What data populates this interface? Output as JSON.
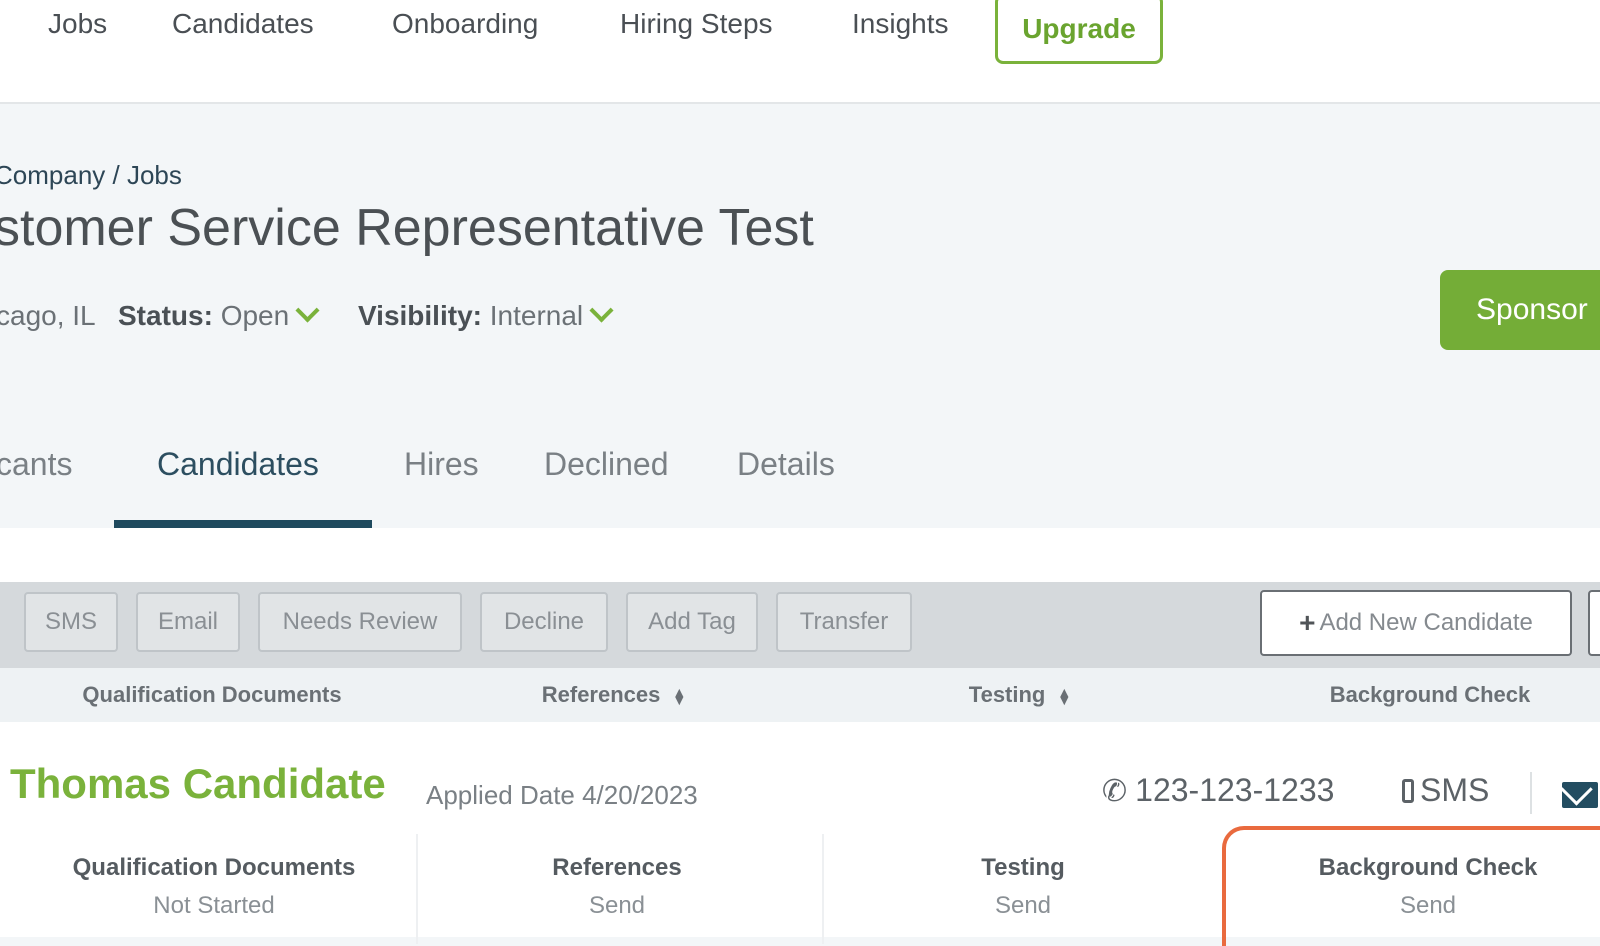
{
  "nav": {
    "items": [
      "Jobs",
      "Candidates",
      "Onboarding",
      "Hiring Steps",
      "Insights"
    ],
    "upgrade_label": "Upgrade"
  },
  "breadcrumb": "Company / Jobs",
  "job": {
    "title": "stomer Service Representative Test",
    "location": "cago, IL",
    "status_label": "Status:",
    "status_value": "Open",
    "visibility_label": "Visibility:",
    "visibility_value": "Internal",
    "sponsor_label": "Sponsor"
  },
  "tabs": [
    "cants",
    "Candidates",
    "Hires",
    "Declined",
    "Details"
  ],
  "toolbar": {
    "buttons": [
      "SMS",
      "Email",
      "Needs Review",
      "Decline",
      "Add Tag",
      "Transfer"
    ],
    "add_candidate_label": "Add New Candidate"
  },
  "columns": [
    "Qualification Documents",
    "References",
    "Testing",
    "Background Check"
  ],
  "candidate": {
    "name": "Thomas Candidate",
    "applied_date": "Applied Date 4/20/2023",
    "phone": "123-123-1233",
    "sms_label": "SMS",
    "steps": [
      {
        "title": "Qualification Documents",
        "status": "Not Started"
      },
      {
        "title": "References",
        "status": "Send"
      },
      {
        "title": "Testing",
        "status": "Send"
      },
      {
        "title": "Background Check",
        "status": "Send"
      }
    ]
  },
  "colors": {
    "accent_green": "#7ab23b",
    "dark_teal": "#1f4a5e",
    "highlight_orange": "#e96a3e"
  }
}
